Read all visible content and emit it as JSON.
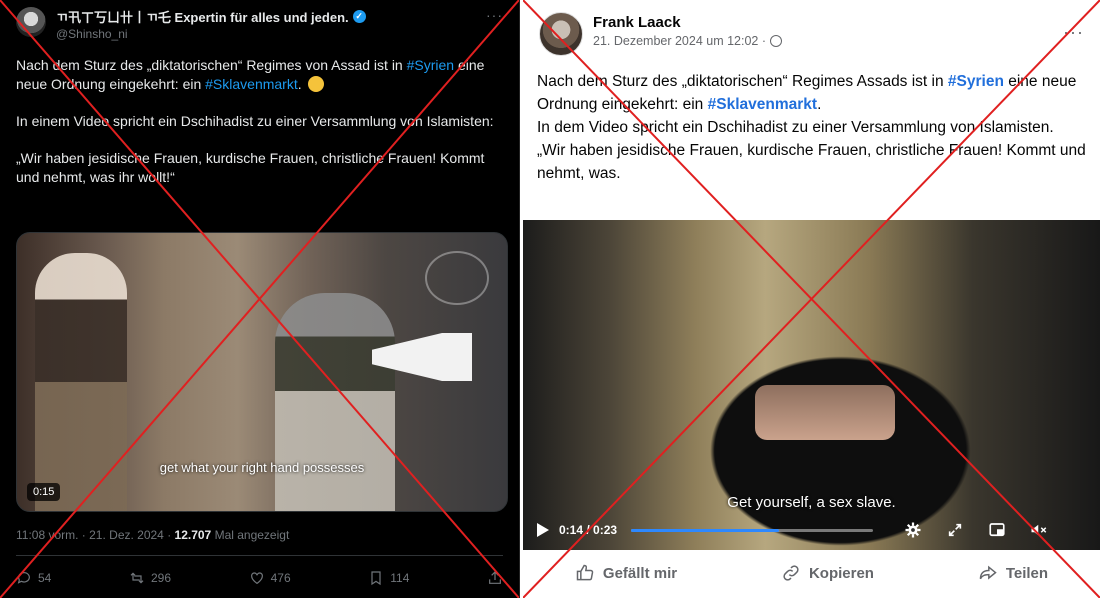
{
  "twitter": {
    "display_name": "ㄲ卂ㄒ丂ㄩ卄丨ㄲ乇 Expertin für alles und jeden.",
    "handle": "@Shinsho_ni",
    "text_line1_pre": "Nach dem Sturz des „diktatorischen“ Regimes von Assad ist in ",
    "hashtag_syrien": "#Syrien",
    "text_line1_mid": " eine neue Ordnung eingekehrt: ein ",
    "hashtag_sklavenmarkt": "#Sklavenmarkt",
    "text_line1_post": ".",
    "paragraph2": "In einem Video spricht ein Dschihadist zu einer Versammlung von Islamisten:",
    "paragraph3": "„Wir haben jesidische Frauen, kurdische Frauen, christliche Frauen! Kommt und nehmt, was ihr wollt!“",
    "video_subtitle": "get what your right hand possesses",
    "video_duration": "0:15",
    "timestamp": "11:08 vorm. · 21. Dez. 2024 · ",
    "views_count": "12.707",
    "views_label": " Mal angezeigt",
    "replies": "54",
    "reposts": "296",
    "likes": "476",
    "bookmarks": "114",
    "icons": [
      "verified-badge-icon",
      "more-icon",
      "reply-icon",
      "repost-icon",
      "like-icon",
      "bookmark-icon",
      "share-icon"
    ]
  },
  "facebook": {
    "display_name": "Frank Laack",
    "date": "21. Dezember 2024 um 12:02 ·",
    "text_pre": "Nach dem Sturz des „diktatorischen“ Regimes Assads ist in ",
    "hashtag_syrien": "#Syrien",
    "text_mid": " eine neue Ordnung eingekehrt: ein ",
    "hashtag_sklavenmarkt": "#Sklavenmarkt",
    "text_post": ".",
    "line2": "In dem Video spricht ein Dschihadist zu einer Versammlung von Islamisten.",
    "line3": " „Wir haben jesidische Frauen, kurdische Frauen, christliche Frauen! Kommt und nehmt, was.",
    "video_subtitle": "Get yourself, a sex slave.",
    "video_time": "0:14 / 0:23",
    "video_progress": 0.61,
    "like_label": "Gefällt mir",
    "copy_label": "Kopieren",
    "share_label": "Teilen",
    "icons": [
      "globe-icon",
      "more-icon",
      "play-icon",
      "settings-icon",
      "fullscreen-icon",
      "pip-icon",
      "mute-icon",
      "thumbs-up-icon",
      "link-icon",
      "share-icon"
    ]
  },
  "colors": {
    "cross": "#e02020",
    "twitter_link": "#1d9bf0",
    "facebook_link": "#216fdb",
    "facebook_progress": "#2d88ff"
  }
}
